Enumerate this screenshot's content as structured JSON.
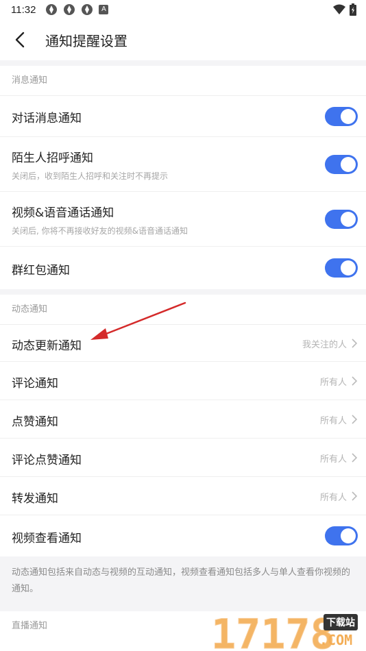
{
  "status_bar": {
    "time": "11:32",
    "notification_badge": "A"
  },
  "header": {
    "title": "通知提醒设置"
  },
  "sections": {
    "message": {
      "label": "消息通知",
      "items": [
        {
          "title": "对话消息通知",
          "toggle_on": true
        },
        {
          "title": "陌生人招呼通知",
          "subtitle": "关闭后，收到陌生人招呼和关注时不再提示",
          "toggle_on": true
        },
        {
          "title": "视频&语音通话通知",
          "subtitle": "关闭后, 你将不再接收好友的视频&语音通话通知",
          "toggle_on": true
        },
        {
          "title": "群红包通知",
          "toggle_on": true
        }
      ]
    },
    "dynamic": {
      "label": "动态通知",
      "items": [
        {
          "title": "动态更新通知",
          "value": "我关注的人"
        },
        {
          "title": "评论通知",
          "value": "所有人"
        },
        {
          "title": "点赞通知",
          "value": "所有人"
        },
        {
          "title": "评论点赞通知",
          "value": "所有人"
        },
        {
          "title": "转发通知",
          "value": "所有人"
        },
        {
          "title": "视频查看通知",
          "toggle_on": true
        }
      ],
      "note": "动态通知包括来自动态与视频的互动通知，视频查看通知包括多人与单人查看你视频的通知。"
    },
    "live": {
      "label": "直播通知"
    }
  },
  "watermark": {
    "number": "17178",
    "badge": "下载站",
    "domain": ".COM"
  },
  "colors": {
    "accent": "#3f73ee",
    "annotation_arrow": "#d42a2a",
    "watermark": "#f0a24a"
  }
}
